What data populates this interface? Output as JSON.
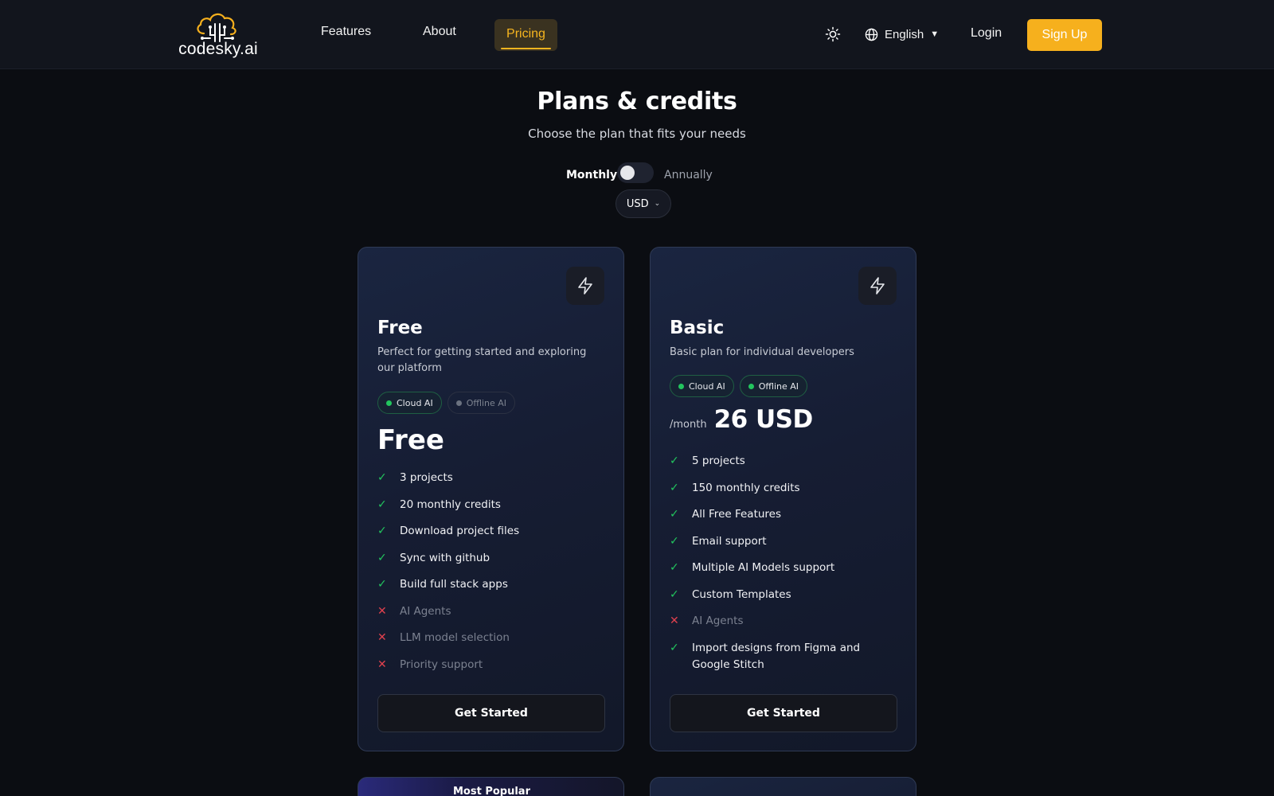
{
  "header": {
    "logo_text": "codesky.ai",
    "nav": [
      "Features",
      "About",
      "Pricing"
    ],
    "language": "English",
    "login_label": "Login",
    "signup_label": "Sign Up",
    "accent_color": "#f6b01d"
  },
  "hero": {
    "title": "Plans & credits",
    "subtitle": "Choose the plan that fits your needs",
    "billing_monthly": "Monthly",
    "billing_annually": "Annually",
    "billing_annual_enabled": false,
    "currency": "USD"
  },
  "plans": [
    {
      "name": "Free",
      "description": "Perfect for getting started and exploring our platform",
      "badges": [
        {
          "label": "Cloud AI",
          "active": true
        },
        {
          "label": "Offline AI",
          "active": false
        }
      ],
      "price": "Free",
      "features": [
        {
          "text": "3 projects",
          "included": true
        },
        {
          "text": "20 monthly credits",
          "included": true
        },
        {
          "text": "Download project files",
          "included": true
        },
        {
          "text": "Sync with github",
          "included": true
        },
        {
          "text": "Build full stack apps",
          "included": true
        },
        {
          "text": "AI Agents",
          "included": false
        },
        {
          "text": "LLM model selection",
          "included": false
        },
        {
          "text": "Priority support",
          "included": false
        }
      ],
      "cta": "Get Started"
    },
    {
      "name": "Basic",
      "description": "Basic plan for individual developers",
      "badges": [
        {
          "label": "Cloud AI",
          "active": true
        },
        {
          "label": "Offline AI",
          "active": true
        }
      ],
      "price_period": "/month",
      "price": "26 USD",
      "features": [
        {
          "text": "5 projects",
          "included": true
        },
        {
          "text": "150 monthly credits",
          "included": true
        },
        {
          "text": "All Free Features",
          "included": true
        },
        {
          "text": "Email support",
          "included": true
        },
        {
          "text": "Multiple AI Models support",
          "included": true
        },
        {
          "text": "Custom Templates",
          "included": true
        },
        {
          "text": "AI Agents",
          "included": false
        },
        {
          "text": "Import designs from Figma and Google Stitch",
          "included": true
        }
      ],
      "cta": "Get Started"
    }
  ],
  "next_row": {
    "popular_label": "Most Popular"
  },
  "icons": {
    "theme": "sun-icon",
    "language": "globe-icon",
    "plan": "bolt-icon",
    "included": "check-icon",
    "excluded": "x-icon"
  }
}
